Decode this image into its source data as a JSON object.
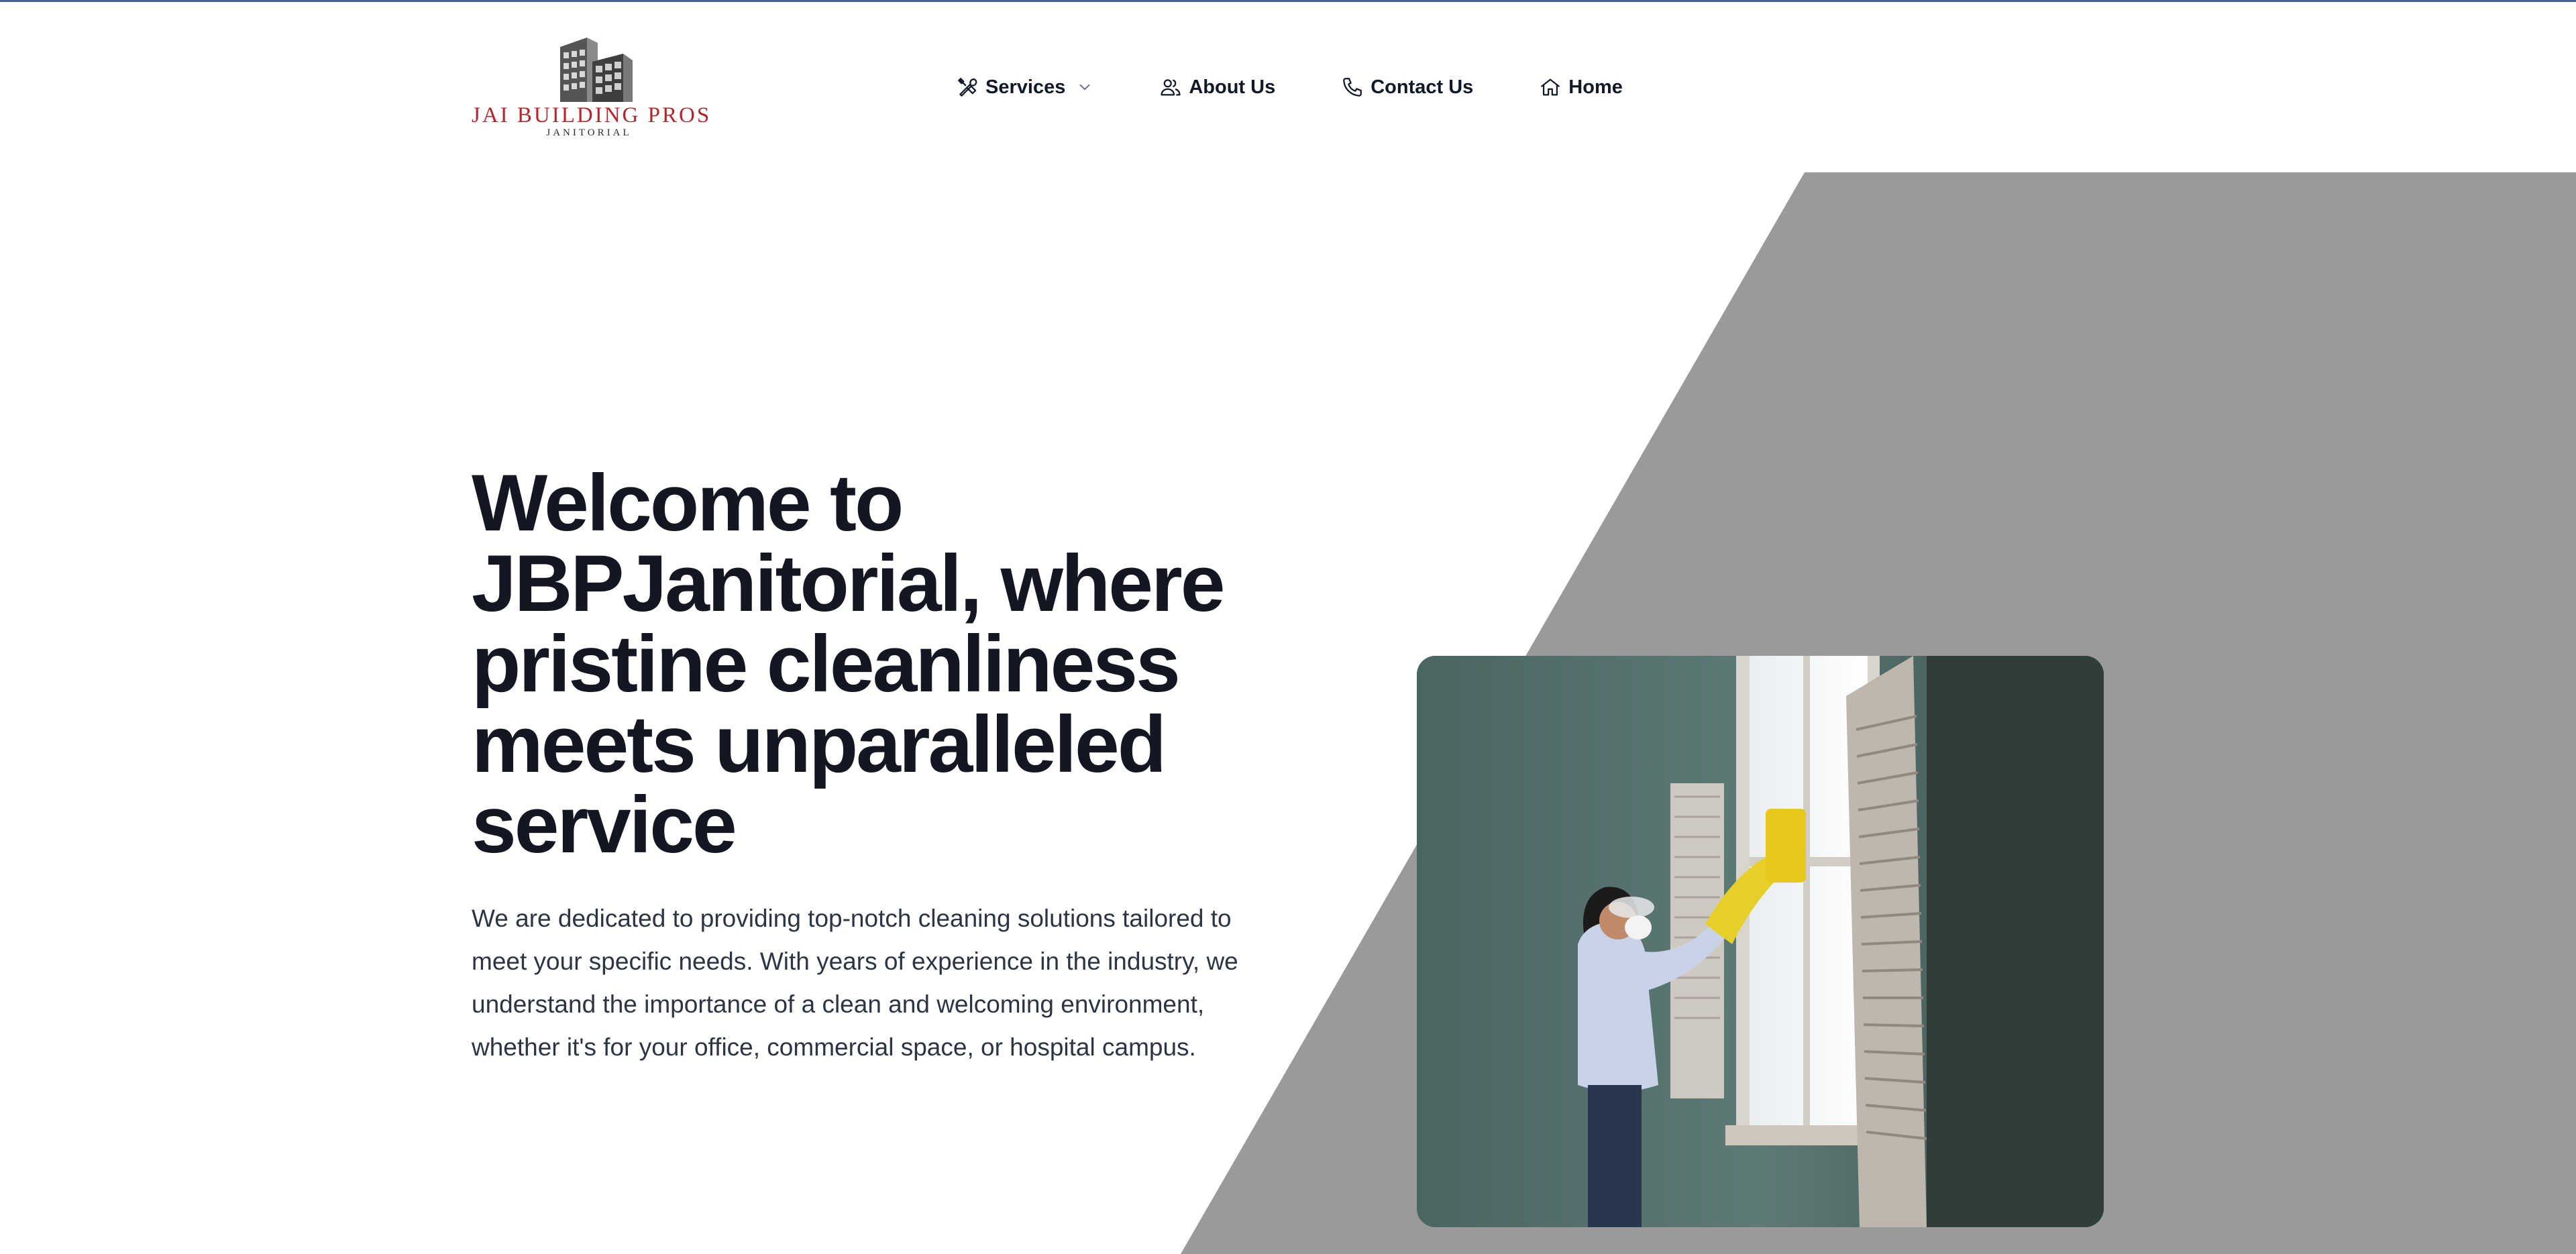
{
  "logo": {
    "title": "JAI BUILDING PROS",
    "subtitle": "JANITORIAL",
    "icon": "buildings-icon"
  },
  "nav": {
    "items": [
      {
        "label": "Services",
        "icon": "tools-icon",
        "has_dropdown": true
      },
      {
        "label": "About Us",
        "icon": "users-icon"
      },
      {
        "label": "Contact Us",
        "icon": "phone-icon"
      },
      {
        "label": "Home",
        "icon": "home-icon"
      }
    ]
  },
  "hero": {
    "title": "Welcome to JBPJanitorial, where pristine cleanliness meets unparalleled service",
    "description": "We are dedicated to providing top-notch cleaning solutions tailored to meet your specific needs. With years of experience in the industry, we understand the importance of a clean and welcoming environment, whether it's for your office, commercial space, or hospital campus."
  },
  "colors": {
    "accent_line": "#4b6496",
    "logo_red": "#b3262b",
    "gray_shape": "#9a9a9a",
    "heading": "#141622"
  }
}
